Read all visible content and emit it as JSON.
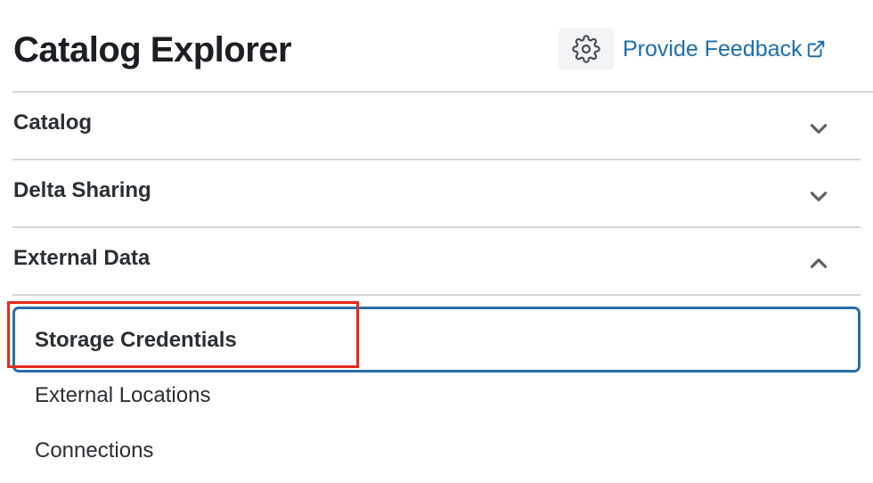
{
  "header": {
    "title": "Catalog Explorer",
    "search_placeholder": "",
    "feedback_label": "Provide Feedback"
  },
  "sections": [
    {
      "label": "Catalog",
      "expanded": false
    },
    {
      "label": "Delta Sharing",
      "expanded": false
    },
    {
      "label": "External Data",
      "expanded": true
    }
  ],
  "external_data_items": [
    {
      "label": "Storage Credentials",
      "selected": true
    },
    {
      "label": "External Locations",
      "selected": false
    },
    {
      "label": "Connections",
      "selected": false
    }
  ],
  "icons": {
    "settings": "gear-icon",
    "external_link": "external-link-icon",
    "collapsed": "chevron-down-icon",
    "expanded": "chevron-up-icon"
  },
  "colors": {
    "link": "#1a6eb0",
    "selected_border": "#2b6ea8",
    "annotation": "#e8291c"
  }
}
